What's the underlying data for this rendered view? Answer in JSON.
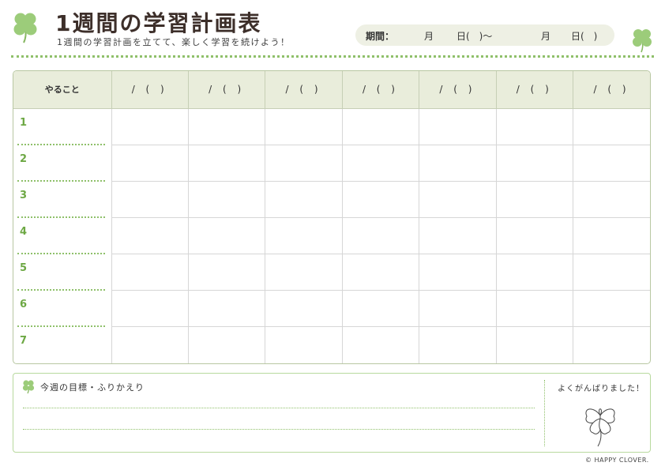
{
  "header": {
    "title": "1週間の学習計画表",
    "subtitle": "1週間の学習計画を立てて、楽しく学習を続けよう！"
  },
  "period": {
    "label": "期間：",
    "month1": "月",
    "day1": "日(　)～",
    "month2": "月",
    "day2": "日(　)"
  },
  "table": {
    "first_header": "やること",
    "day_headers": [
      "/ ( )",
      "/ ( )",
      "/ ( )",
      "/ ( )",
      "/ ( )",
      "/ ( )",
      "/ ( )"
    ],
    "rows": [
      "1",
      "2",
      "3",
      "4",
      "5",
      "6",
      "7"
    ]
  },
  "goal": {
    "label": "今週の目標・ふりかえり",
    "praise_label": "よくがんばりました！"
  },
  "footer": {
    "copyright": "© HAPPY CLOVER."
  },
  "colors": {
    "accent_green": "#8fc06a",
    "header_bg": "#e9eddb",
    "title_brown": "#3d2f2a"
  },
  "icons": [
    "clover-icon",
    "clover-outline-icon"
  ]
}
